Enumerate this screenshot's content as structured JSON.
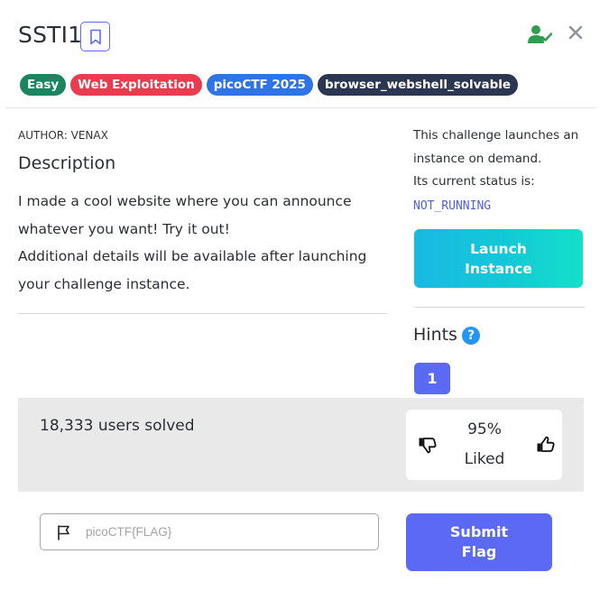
{
  "challenge": {
    "title": "SSTI1",
    "author": "AUTHOR: VENAX",
    "description_heading": "Description",
    "description_lines": [
      "I made a cool website where you can announce whatever you want! Try it out!",
      "Additional details will be available after launching your challenge instance."
    ]
  },
  "tags": [
    {
      "label": "Easy",
      "color": "#1b8560"
    },
    {
      "label": "Web Exploitation",
      "color": "#ea3c4e"
    },
    {
      "label": "picoCTF 2025",
      "color": "#2f74e6"
    },
    {
      "label": "browser_webshell_solvable",
      "color": "#2b3750"
    }
  ],
  "instance": {
    "text": "This challenge launches an instance on demand.",
    "status_label": "Its current status is:",
    "status_value": "NOT_RUNNING",
    "launch_label": "Launch Instance"
  },
  "hints": {
    "heading": "Hints",
    "help_icon": "?",
    "items": [
      "1"
    ]
  },
  "stats": {
    "solved": "18,333 users solved",
    "liked_percent": "95%",
    "liked_label": "Liked"
  },
  "flag": {
    "placeholder": "picoCTF{FLAG}",
    "submit_label": "Submit Flag"
  },
  "icons": {
    "bookmark": "bookmark-icon",
    "user_check": "user-check-icon",
    "close": "close-icon",
    "thumbs_down": "thumbs-down-icon",
    "thumbs_up": "thumbs-up-icon",
    "flag": "flag-icon",
    "help": "help-icon"
  },
  "colors": {
    "accent": "#5b6af5",
    "status": "#4f5fe8",
    "user_check": "#2e9e4f"
  }
}
